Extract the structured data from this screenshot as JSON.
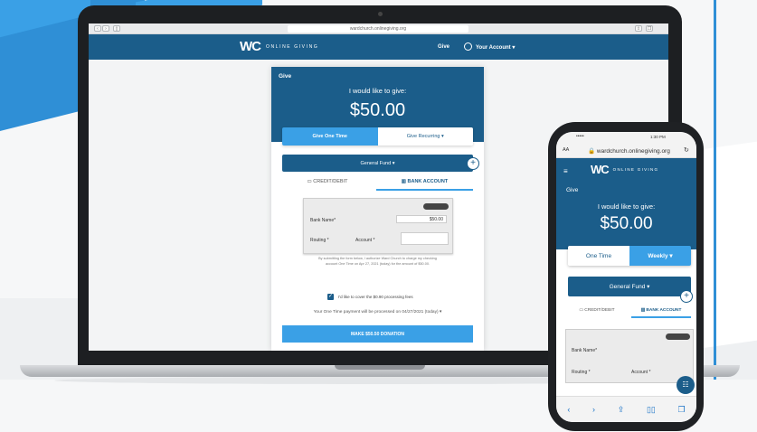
{
  "colors": {
    "brand": "#1b5d8a",
    "accent": "#3aa0e6",
    "background": "#f3f4f5"
  },
  "laptop": {
    "browser": {
      "url": "wardchurch.onlinegiving.org",
      "reload_icon": "reload-icon"
    },
    "header": {
      "logo_mark": "WC",
      "logo_text": "ONLINE GIVING",
      "nav_give": "Give",
      "nav_account": "Your Account ▾"
    },
    "form": {
      "title": "Give",
      "prompt": "I would like to give:",
      "amount": "$50.00",
      "frequency": {
        "one_time": "Give One Time",
        "recurring": "Give Recurring ▾"
      },
      "fund": "General Fund ▾",
      "tabs": {
        "credit": "▭ CREDIT/DEBIT",
        "bank": "▥ BANK ACCOUNT"
      },
      "check": {
        "bank_name_label": "Bank Name*",
        "amount_value": "$50.00",
        "routing_label": "Routing *",
        "account_label": "Account *"
      },
      "disclaimer": "By submitting the form below, I authorize Ward Church to charge my checking account One Time on Apr 27, 2021 (today) for the amount of $50.00.",
      "cover_fees": "I'd like to cover the $0.90 processing fees",
      "process_date": "Your One Time payment will be processed on 04/27/2021 (today) ▾",
      "donate_button": "MAKE $50.50 DONATION"
    }
  },
  "phone": {
    "status": {
      "signal": "•••••",
      "time": "1:30 PM"
    },
    "browser": {
      "aa": "AA",
      "url": "🔒 wardchurch.onlinegiving.org",
      "reload": "↻"
    },
    "header": {
      "menu": "≡",
      "logo_mark": "WC",
      "logo_text": "ONLINE GIVING"
    },
    "form": {
      "title": "Give",
      "prompt": "I would like to give:",
      "amount": "$50.00",
      "frequency": {
        "one_time": "One Time",
        "weekly": "Weekly ▾"
      },
      "fund": "General Fund ▾",
      "tabs": {
        "credit": "▭ CREDIT/DEBIT",
        "bank": "▥ BANK ACCOUNT"
      },
      "check": {
        "bank_name_label": "Bank Name*",
        "routing_label": "Routing *",
        "account_label": "Account *"
      }
    },
    "toolbar": {
      "back": "‹",
      "forward": "›",
      "share": "⇪",
      "bookmarks": "▯▯",
      "tabs": "❐"
    }
  }
}
